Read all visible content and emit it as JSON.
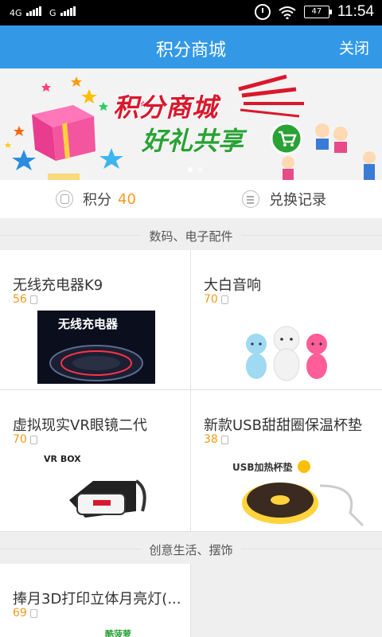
{
  "status_bar": {
    "sim1": "4G",
    "sim2": "G",
    "battery": "47",
    "time": "11:54"
  },
  "header": {
    "title": "积分商城",
    "close_label": "关闭"
  },
  "banner": {
    "line1": "积分商城",
    "line2": "好礼共享"
  },
  "points": {
    "label": "积分",
    "value": "40",
    "history_label": "兑换记录"
  },
  "sections": [
    {
      "title": "数码、电子配件",
      "items": [
        {
          "name": "无线充电器K9",
          "price": "56",
          "image_text": "无线充电器"
        },
        {
          "name": "大白音响",
          "price": "70"
        },
        {
          "name": "虚拟现实VR眼镜二代",
          "price": "70",
          "image_text": "VR BOX"
        },
        {
          "name": "新款USB甜甜圈保温杯垫",
          "price": "38",
          "image_text": "USB加热杯垫"
        }
      ]
    },
    {
      "title": "创意生活、摆饰",
      "items": [
        {
          "name": "捧月3D打印立体月亮灯(...",
          "price": "69",
          "image_text": "酷菠萝"
        }
      ]
    }
  ],
  "colors": {
    "accent": "#3399e6",
    "price": "#f39a1b"
  }
}
